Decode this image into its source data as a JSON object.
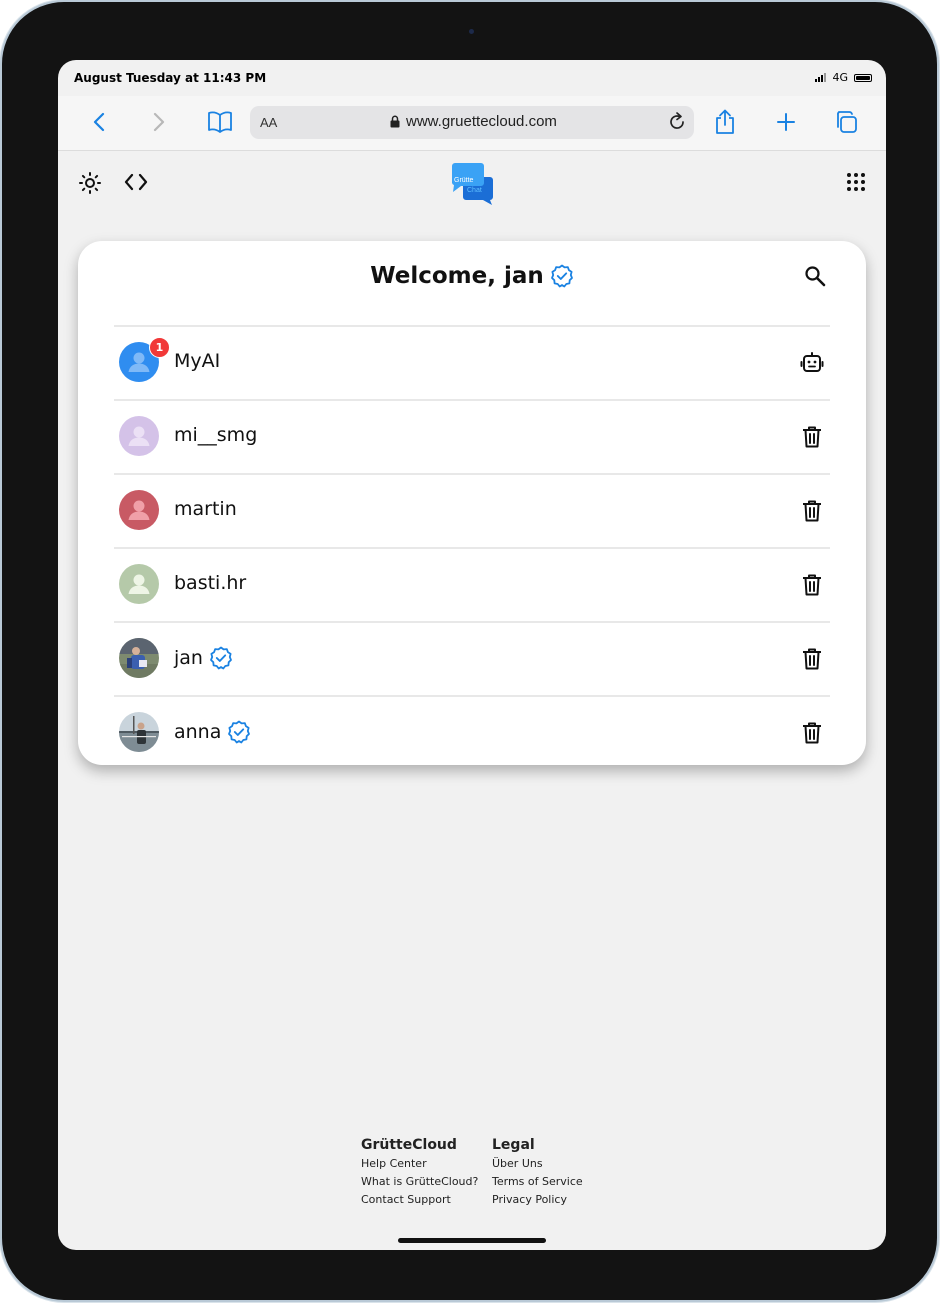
{
  "status": {
    "time": "August Tuesday at 11:43 PM",
    "network": "4G"
  },
  "browser": {
    "reader_label": "AA",
    "url": "www.gruettecloud.com"
  },
  "app": {
    "logo_top": "Grütte",
    "logo_bottom": "Chat"
  },
  "card": {
    "title": "Welcome, jan"
  },
  "chats": [
    {
      "name": "MyAI",
      "badge": "1",
      "verified": false,
      "action": "bot-icon",
      "avatar_color": "#2f8df0"
    },
    {
      "name": "mi__smg",
      "verified": false,
      "action": "trash-icon",
      "avatar_color": "#d4c2e8"
    },
    {
      "name": "martin",
      "verified": false,
      "action": "trash-icon",
      "avatar_color": "#c85a64"
    },
    {
      "name": "basti.hr",
      "verified": false,
      "action": "trash-icon",
      "avatar_color": "#b5c9a9"
    },
    {
      "name": "jan",
      "verified": true,
      "action": "trash-icon",
      "avatar_color": "#5b6b7a"
    },
    {
      "name": "anna",
      "verified": true,
      "action": "trash-icon",
      "avatar_color": "#8a9aa8"
    }
  ],
  "footer": {
    "col1": {
      "heading": "GrütteCloud",
      "links": [
        "Help Center",
        "What is GrütteCloud?",
        "Contact Support"
      ]
    },
    "col2": {
      "heading": "Legal",
      "links": [
        "Über Uns",
        "Terms of Service",
        "Privacy Policy"
      ]
    }
  },
  "colors": {
    "accent": "#1a82e2",
    "badge": "#f13838"
  }
}
